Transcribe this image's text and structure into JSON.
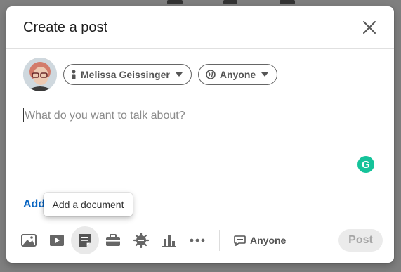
{
  "modal": {
    "title": "Create a post"
  },
  "author": {
    "name": "Melissa Geissinger",
    "audience": "Anyone"
  },
  "editor": {
    "placeholder": "What do you want to talk about?"
  },
  "add_link_label": "Add",
  "tooltip": "Add a document",
  "toolbar": {
    "icons": [
      "photo-icon",
      "video-icon",
      "document-icon",
      "job-icon",
      "celebrate-icon",
      "poll-icon",
      "more-icon"
    ],
    "comment_visibility": "Anyone",
    "post_label": "Post"
  },
  "colors": {
    "link": "#0a66c2",
    "grammarly": "#15c39a",
    "post_disabled_bg": "#ebebeb"
  }
}
